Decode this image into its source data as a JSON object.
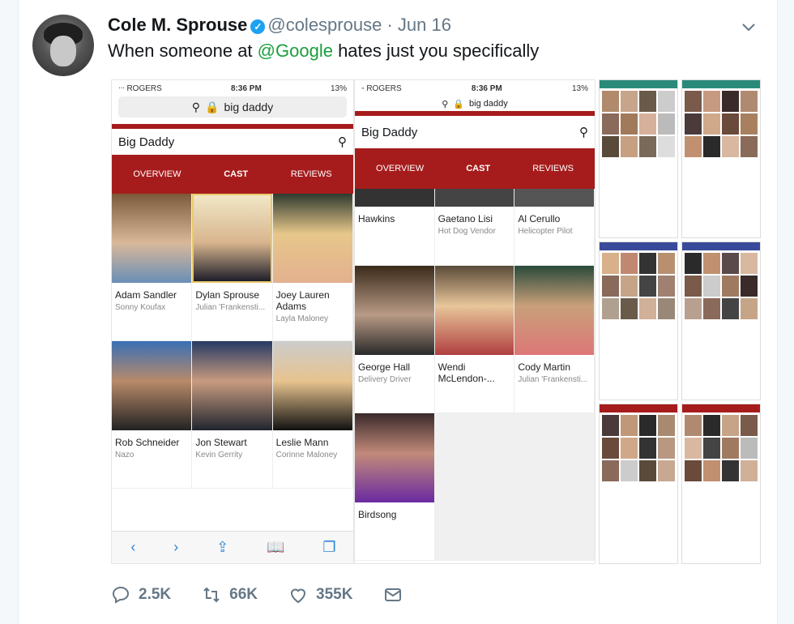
{
  "tweet": {
    "name": "Cole M. Sprouse",
    "handle": "@colesprouse",
    "separator": "·",
    "date": "Jun 16",
    "text_before": "When someone at ",
    "mention": "@Google",
    "text_after": " hates just you specifically"
  },
  "screenshot1": {
    "carrier": "ᐧᐧᐧ ROGERS",
    "time": "8:36 PM",
    "battery": "13%",
    "url": "big daddy",
    "search_text": "Big Daddy",
    "tabs": [
      "OVERVIEW",
      "CAST",
      "REVIEWS"
    ],
    "cast": [
      {
        "name": "Adam Sandler",
        "role": "Sonny Koufax"
      },
      {
        "name": "Dylan Sprouse",
        "role": "Julian 'Frankensti..."
      },
      {
        "name": "Joey Lauren Adams",
        "role": "Layla Maloney"
      },
      {
        "name": "Rob Schneider",
        "role": "Nazo"
      },
      {
        "name": "Jon Stewart",
        "role": "Kevin Gerrity"
      },
      {
        "name": "Leslie Mann",
        "role": "Corinne Maloney"
      }
    ]
  },
  "screenshot2": {
    "carrier": "◦ ROGERS",
    "time": "8:36 PM",
    "battery": "13%",
    "url": "big daddy",
    "search_text": "Big Daddy",
    "tabs": [
      "OVERVIEW",
      "CAST",
      "REVIEWS"
    ],
    "cast": [
      {
        "name": "Hawkins",
        "role": ""
      },
      {
        "name": "Gaetano Lisi",
        "role": "Hot Dog Vendor"
      },
      {
        "name": "Al Cerullo",
        "role": "Helicopter Pilot"
      },
      {
        "name": "George Hall",
        "role": "Delivery Driver"
      },
      {
        "name": "Wendi McLendon-...",
        "role": ""
      },
      {
        "name": "Cody Martin",
        "role": "Julian 'Frankensti..."
      },
      {
        "name": "Birdsong",
        "role": ""
      }
    ]
  },
  "actions": {
    "replies": "2.5K",
    "retweets": "66K",
    "likes": "355K"
  },
  "colors": {
    "brand_red": "#a61c1c",
    "mention_green": "#1b9e3e",
    "muted": "#657786"
  }
}
